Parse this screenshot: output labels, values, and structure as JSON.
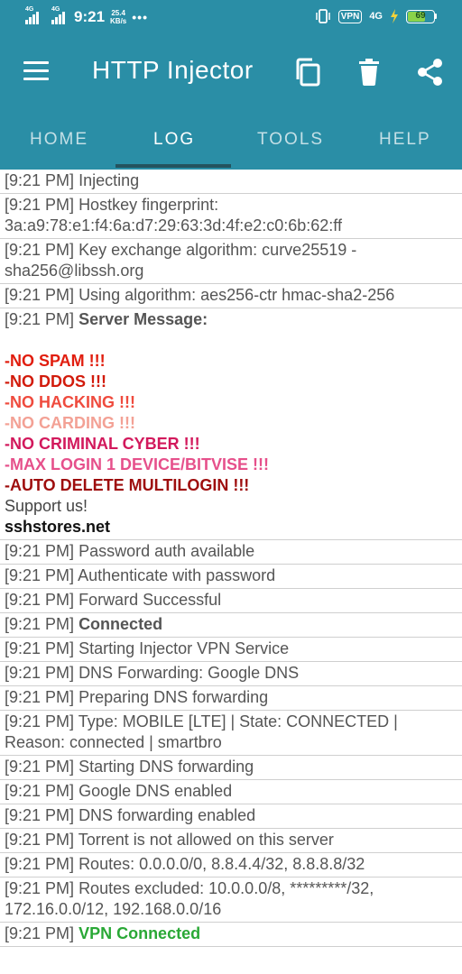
{
  "status_bar": {
    "net1": "4G",
    "net2": "4G",
    "time": "9:21",
    "speed_value": "25.4",
    "speed_unit": "KB/s",
    "dots": "•••",
    "vpn_badge": "VPN",
    "net3": "4G",
    "battery_level": "69",
    "battery_color": "#8bd34a"
  },
  "appbar": {
    "title": "HTTP Injector",
    "color": "#2a8ea6"
  },
  "tabs": [
    {
      "label": "HOME"
    },
    {
      "label": "LOG"
    },
    {
      "label": "TOOLS"
    },
    {
      "label": "HELP"
    }
  ],
  "active_tab": "LOG",
  "log": {
    "ts": "[9:21 PM]",
    "r1": "Injecting",
    "r2": "Hostkey fingerprint: 3a:a9:78:e1:f4:6a:d7:29:63:3d:4f:e2:c0:6b:62:ff",
    "r3": "Key exchange algorithm: curve25519 -sha256@libssh.org",
    "r4": "Using algorithm: aes256-ctr hmac-sha2-256",
    "r5_label": "Server Message:",
    "server_message": [
      {
        "text": "-NO SPAM !!!",
        "color": "#e11d0e"
      },
      {
        "text": "-NO DDOS !!!",
        "color": "#d21b0b"
      },
      {
        "text": "-NO HACKING !!!",
        "color": "#ef4b3e"
      },
      {
        "text": "-NO CARDING !!!",
        "color": "#f3a195"
      },
      {
        "text": "-NO CRIMINAL CYBER !!!",
        "color": "#d2195c"
      },
      {
        "text": "-MAX LOGIN 1 DEVICE/BITVISE !!!",
        "color": "#e6508b"
      },
      {
        "text": "-AUTO DELETE MULTILOGIN !!!",
        "color": "#9e0d0d"
      }
    ],
    "support": "Support us!",
    "site": "sshstores.net",
    "r6": "Password auth available",
    "r7": "Authenticate with password",
    "r8": "Forward Successful",
    "r9": "Connected",
    "r10": "Starting Injector VPN Service",
    "r11": "DNS Forwarding: Google DNS",
    "r12": "Preparing DNS forwarding",
    "r13": "Type: MOBILE [LTE] | State: CONNECTED | Reason: connected | smartbro",
    "r14": "Starting DNS forwarding",
    "r15": "Google DNS enabled",
    "r16": "DNS forwarding enabled",
    "r17": "Torrent is not allowed on this server",
    "r18": "Routes: 0.0.0.0/0, 8.8.4.4/32, 8.8.8.8/32",
    "r19": "Routes excluded: 10.0.0.0/8, *********/32, 172.16.0.0/12, 192.168.0.0/16",
    "r20": "VPN Connected"
  }
}
